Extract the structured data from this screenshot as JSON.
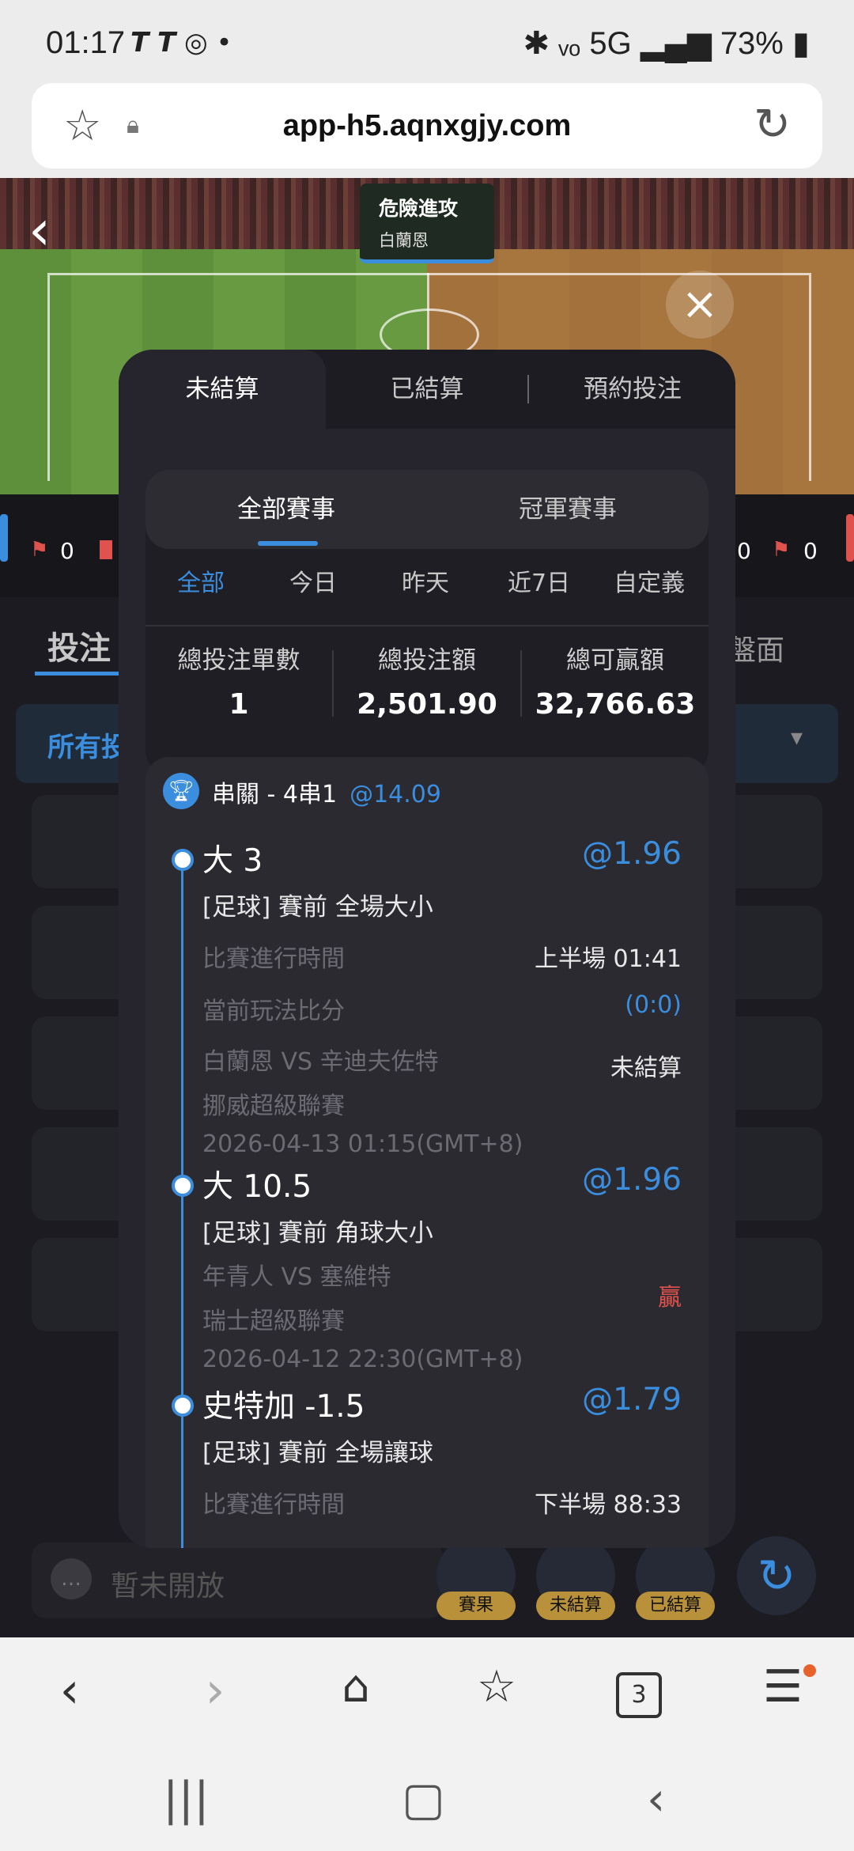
{
  "status": {
    "time": "01:17",
    "left_icons": "𝙏 𝙏 ◎ •",
    "right": "✱ ᵥₒ 5G ▂▄▆ 73% ▮"
  },
  "browser": {
    "url": "app-h5.aqnxgjy.com"
  },
  "live": {
    "event_title": "危險進攻",
    "event_team": "白蘭恩"
  },
  "score_left": {
    "corners": "0"
  },
  "score_right": {
    "corners": "0",
    "cards": "0"
  },
  "background": {
    "bet_label": "投注",
    "all_label": "所有投",
    "face_label": "盤面",
    "chat_placeholder": "暫未開放",
    "quick": [
      "賽果",
      "未結算",
      "已結算"
    ]
  },
  "tabs": [
    "未結算",
    "已結算",
    "預約投注"
  ],
  "segments": [
    "全部賽事",
    "冠軍賽事"
  ],
  "filters": [
    "全部",
    "今日",
    "昨天",
    "近7日",
    "自定義"
  ],
  "stats": [
    {
      "label": "總投注單數",
      "value": "1"
    },
    {
      "label": "總投注額",
      "value": "2,501.90"
    },
    {
      "label": "總可贏額",
      "value": "32,766.63"
    }
  ],
  "parlay": {
    "title": "串關 - 4串1",
    "odds": "@14.09"
  },
  "legs": [
    {
      "selection": "大 3",
      "odds": "@1.96",
      "market": "[足球] 賽前 全場大小",
      "time_label": "比賽進行時間",
      "time_value": "上半場  01:41",
      "score_label": "當前玩法比分",
      "score_value": "(0:0)",
      "match": "白蘭恩 VS 辛迪夫佐特",
      "status": "未結算",
      "league": "挪威超級聯賽",
      "datetime": "2026-04-13 01:15(GMT+8)"
    },
    {
      "selection": "大 10.5",
      "odds": "@1.96",
      "market": "[足球] 賽前 角球大小",
      "match": "年青人 VS 塞維特",
      "status": "贏",
      "league": "瑞士超級聯賽",
      "datetime": "2026-04-12 22:30(GMT+8)"
    },
    {
      "selection": "史特加 -1.5",
      "odds": "@1.79",
      "market": "[足球] 賽前 全場讓球",
      "time_label": "比賽進行時間",
      "time_value": "下半場  88:33"
    }
  ],
  "nav": {
    "tabs_count": "3"
  }
}
